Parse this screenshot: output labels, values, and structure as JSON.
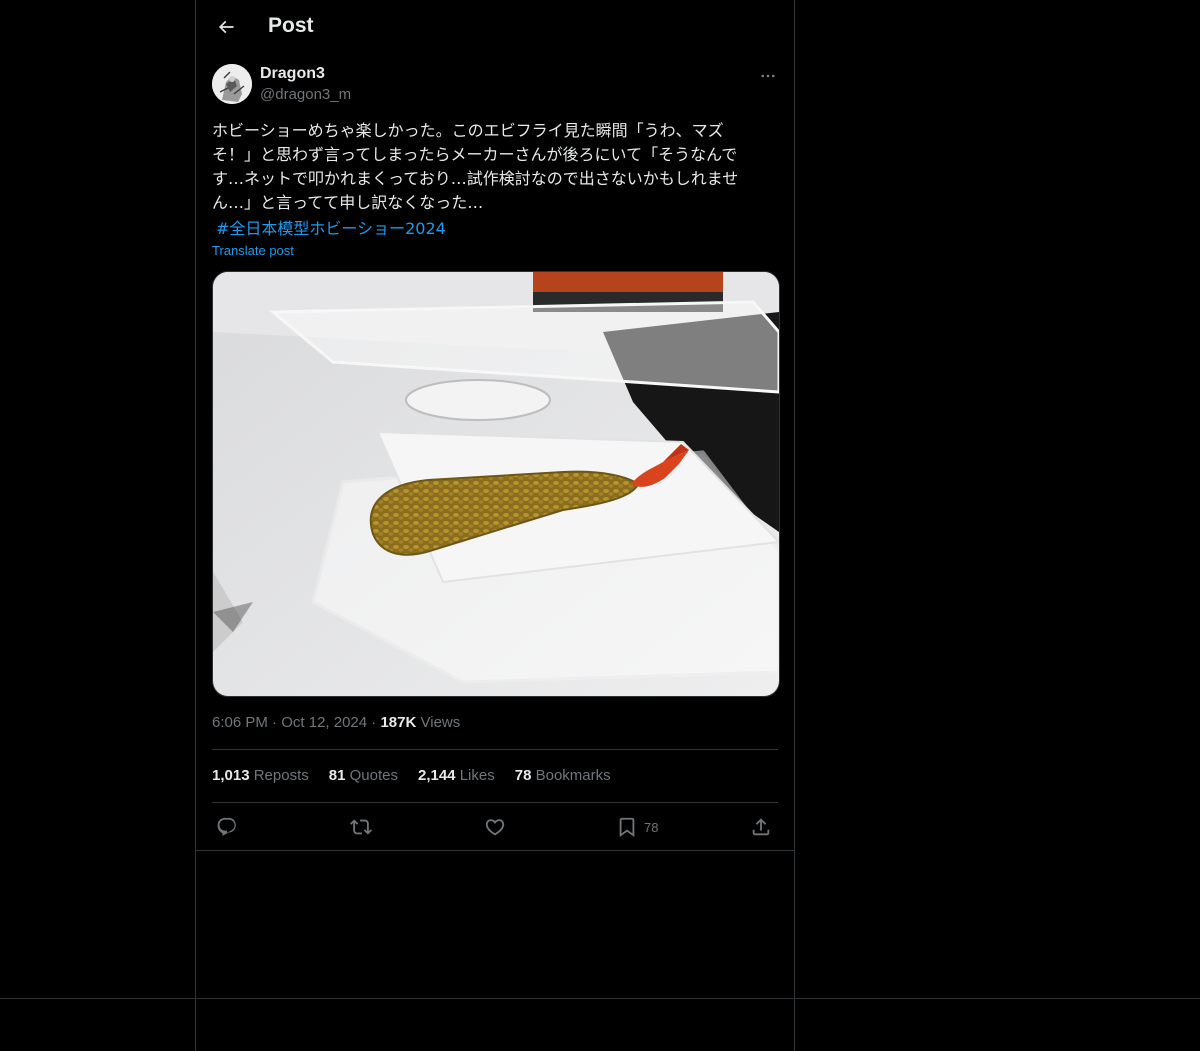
{
  "header": {
    "title": "Post"
  },
  "post": {
    "author_name": "Dragon3",
    "author_handle": "@dragon3_m",
    "text": "ホビーショーめちゃ楽しかった。このエビフライ見た瞬間「うわ、マズ\nそ！」と思わず言ってしまったらメーカーさんが後ろにいて「そうなんで\nす…ネットで叩かれまくっており…試作検討なので出さないかもしれませ\nん…」と言ってて申し訳なくなった…",
    "hashtag": "#全日本模型ホビーショー2024",
    "translate_label": "Translate post",
    "time": "6:06 PM",
    "date": "Oct 12, 2024",
    "views_count": "187K",
    "views_label": "Views"
  },
  "stats": {
    "reposts_count": "1,013",
    "reposts_label": "Reposts",
    "quotes_count": "81",
    "quotes_label": "Quotes",
    "likes_count": "2,144",
    "likes_label": "Likes",
    "bookmarks_count": "78",
    "bookmarks_label": "Bookmarks"
  },
  "actions": {
    "bookmark_count": "78"
  },
  "icons": [
    "back-arrow-icon",
    "more-icon",
    "reply-icon",
    "repost-icon",
    "like-icon",
    "bookmark-icon",
    "share-icon"
  ],
  "colors": {
    "background": "#000000",
    "text": "#e7e9ea",
    "muted": "#71767b",
    "accent": "#1d9bf0",
    "border": "#2f3336"
  }
}
